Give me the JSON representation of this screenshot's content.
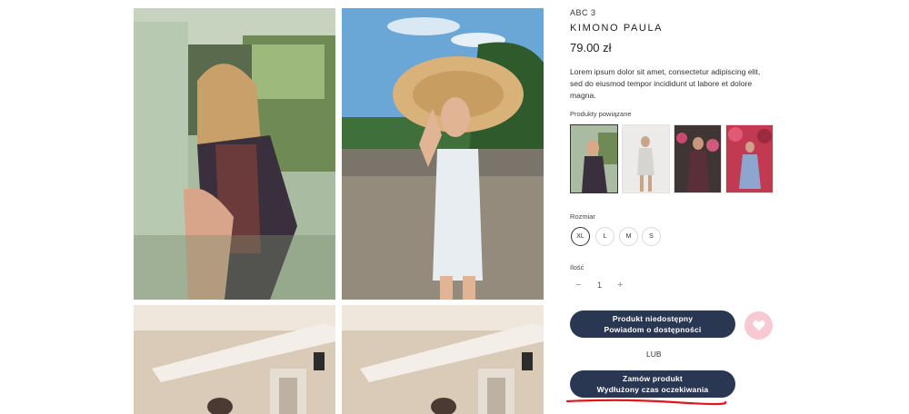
{
  "product": {
    "brand": "ABC 3",
    "title": "KIMONO PAULA",
    "price": "79.00 zł",
    "description": "Lorem ipsum dolor sit amet, consectetur adipiscing elit, sed do eiusmod tempor incididunt ut labore et dolore magna."
  },
  "related": {
    "label": "Produkty powiązane"
  },
  "size": {
    "label": "Rozmiar",
    "options": [
      "XL",
      "L",
      "M",
      "S"
    ],
    "selected": "XL"
  },
  "quantity": {
    "label": "Ilość",
    "minus": "−",
    "value": "1",
    "plus": "+"
  },
  "buttons": {
    "unavailable_line1": "Produkt niedostępny",
    "unavailable_line2": "Powiadom o dostępności",
    "or": "LUB",
    "order_line1": "Zamów produkt",
    "order_line2": "Wydłużony czas oczekiwania"
  },
  "colors": {
    "button_bg": "#2a3752",
    "favorite_bg": "#f7c9d3",
    "annotation_red": "#e3141b"
  },
  "icons": [
    "heart-icon",
    "minus-icon",
    "plus-icon"
  ]
}
